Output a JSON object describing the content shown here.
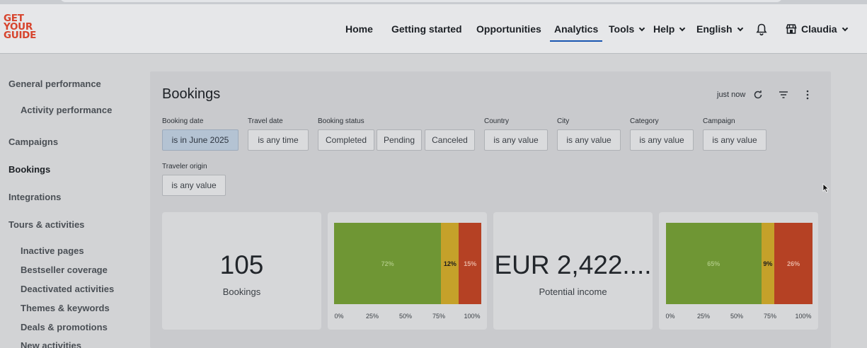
{
  "logo": {
    "lines": [
      "GET",
      "YOUR",
      "GUIDE"
    ]
  },
  "nav": {
    "home": "Home",
    "getting_started": "Getting started",
    "opportunities": "Opportunities",
    "analytics": "Analytics",
    "tools": "Tools",
    "help": "Help",
    "language": "English",
    "user": "Claudia"
  },
  "sidebar": {
    "general_performance": "General performance",
    "activity_performance": "Activity performance",
    "campaigns": "Campaigns",
    "bookings": "Bookings",
    "integrations": "Integrations",
    "tours_activities": "Tours & activities",
    "inactive_pages": "Inactive pages",
    "bestseller_coverage": "Bestseller coverage",
    "deactivated_activities": "Deactivated activities",
    "themes_keywords": "Themes & keywords",
    "deals_promotions": "Deals & promotions",
    "new_activities": "New activities"
  },
  "panel": {
    "title": "Bookings",
    "refresh_status": "just now"
  },
  "filters": {
    "booking_date_label": "Booking date",
    "booking_date_value": "is in June 2025",
    "travel_date_label": "Travel date",
    "travel_date_value": "is any time",
    "booking_status_label": "Booking status",
    "status_completed": "Completed",
    "status_pending": "Pending",
    "status_canceled": "Canceled",
    "country_label": "Country",
    "country_value": "is any value",
    "city_label": "City",
    "city_value": "is any value",
    "category_label": "Category",
    "category_value": "is any value",
    "campaign_label": "Campaign",
    "campaign_value": "is any value",
    "traveler_origin_label": "Traveler origin",
    "traveler_origin_value": "is any value"
  },
  "cards": {
    "bookings_value": "105",
    "bookings_label": "Bookings",
    "income_value": "EUR 2,422....",
    "income_label": "Potential income"
  },
  "bars": {
    "bookings_bar": {
      "segments": [
        {
          "label": "72%",
          "value": 72,
          "status": "completed"
        },
        {
          "label": "12%",
          "value": 12,
          "status": "pending"
        },
        {
          "label": "15%",
          "value": 15,
          "status": "canceled"
        }
      ]
    },
    "income_bar": {
      "segments": [
        {
          "label": "65%",
          "value": 65,
          "status": "completed"
        },
        {
          "label": "9%",
          "value": 9,
          "status": "pending"
        },
        {
          "label": "26%",
          "value": 26,
          "status": "canceled"
        }
      ]
    },
    "ticks": [
      "0%",
      "25%",
      "50%",
      "75%",
      "100%"
    ]
  },
  "colors": {
    "brand": "#d7442d",
    "completed": "#6f9634",
    "pending": "#c5a12a",
    "canceled": "#b54124",
    "selected_filter": "#b4c3d3",
    "active_underline": "#1a56b0"
  }
}
